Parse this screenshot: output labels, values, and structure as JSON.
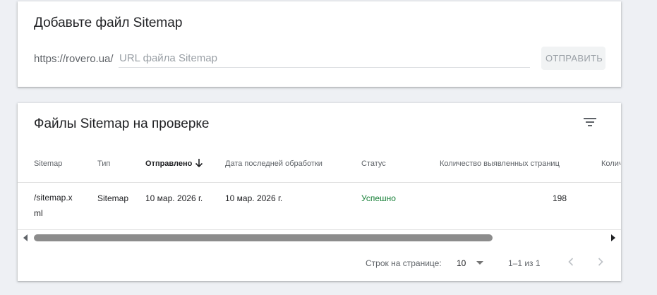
{
  "add_sitemap": {
    "title": "Добавьте файл Sitemap",
    "url_prefix": "https://rovero.ua/",
    "input_placeholder": "URL файла Sitemap",
    "input_value": "",
    "submit_label": "ОТПРАВИТЬ"
  },
  "sitemaps_list": {
    "title": "Файлы Sitemap на проверке",
    "filter_icon": "filter-list-icon",
    "columns": {
      "sitemap": "Sitemap",
      "type": "Тип",
      "submitted": "Отправлено",
      "last_read": "Дата последней обработки",
      "status": "Статус",
      "discovered_pages": "Количество выявленных страниц",
      "next_col_partial": "Колич"
    },
    "sorted_column": "submitted",
    "sort_direction": "descending",
    "rows": [
      {
        "sitemap": "/sitemap.xml",
        "type": "Sitemap",
        "submitted": "10 мар. 2026 г.",
        "last_read": "10 мар. 2026 г.",
        "status": "Успешно",
        "discovered_pages": "198"
      }
    ],
    "status_color": "#188038",
    "pagination": {
      "rows_per_page_label": "Строк на странице:",
      "rows_per_page_value": "10",
      "range": "1–1 из 1"
    }
  }
}
